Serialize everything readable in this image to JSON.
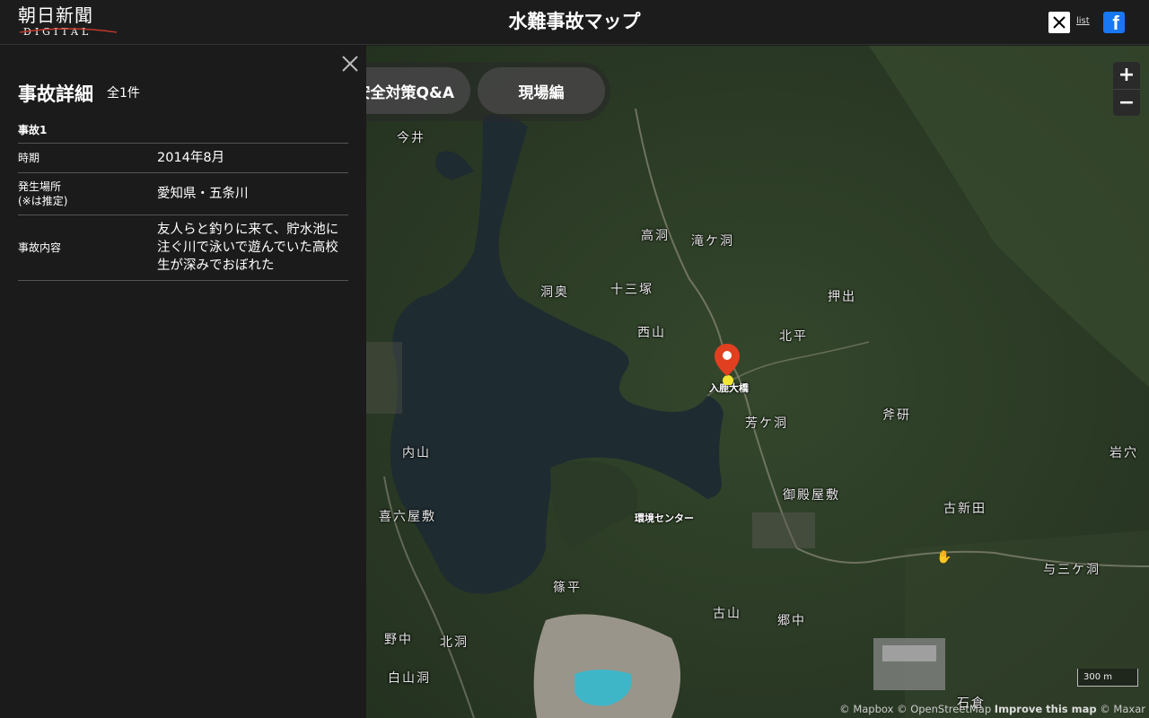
{
  "header": {
    "logo_text": "朝日新聞",
    "logo_subtext": "DIGITAL",
    "title": "水難事故マップ",
    "list_label": "list",
    "x_icon": "x-icon",
    "facebook_icon": "facebook-icon"
  },
  "map": {
    "chips": [
      "安全対策Q&A",
      "現場編"
    ],
    "zoom_in": "+",
    "zoom_out": "−",
    "scale_label": "300 m",
    "attribution": {
      "mapbox": "© Mapbox",
      "osm": "© OpenStreetMap",
      "improve": "Improve this map",
      "maxar": "© Maxar"
    },
    "places": {
      "p1": "今井",
      "p2": "高洞",
      "p3": "滝ケ洞",
      "p4": "洞奥",
      "p5": "十三塚",
      "p6": "押出",
      "p7": "西山",
      "p8": "北平",
      "p9": "芳ケ洞",
      "p10": "斧研",
      "p11": "内山",
      "p12": "岩穴",
      "p13": "御殿屋敷",
      "p14": "喜六屋敷",
      "p15": "古新田",
      "p16": "与三ケ洞",
      "p17": "篠平",
      "p18": "古山",
      "p19": "郷中",
      "p20": "野中",
      "p21": "北洞",
      "p22": "白山洞",
      "p23": "石倉"
    },
    "poi": {
      "bridge": "入鹿大橋",
      "center": "環境センター"
    },
    "colors": {
      "marker": "#e0401f",
      "lake": "#1f2a30",
      "forest": "#2d3d27"
    }
  },
  "panel": {
    "title": "事故詳細",
    "count": "全1件",
    "section": "事故1",
    "rows": [
      {
        "key": "時期",
        "value": "2014年8月"
      },
      {
        "key": "発生場所\n(※は推定)",
        "value": "愛知県・五条川"
      },
      {
        "key": "事故内容",
        "value": "友人らと釣りに来て、貯水池に注ぐ川で泳いで遊んでいた高校生が深みでおぼれた"
      }
    ]
  }
}
